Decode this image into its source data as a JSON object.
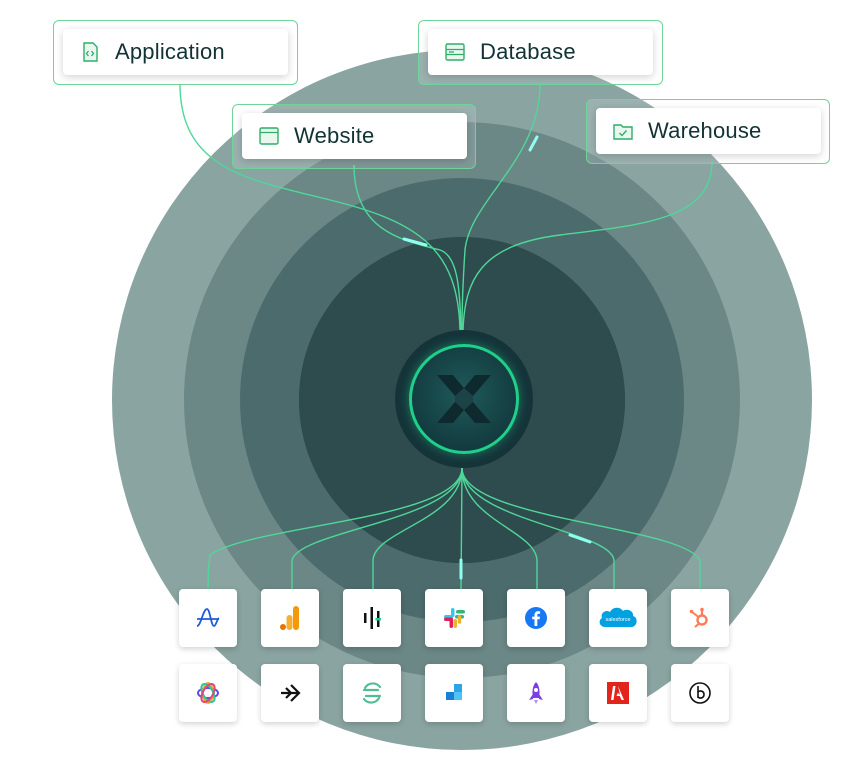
{
  "sources": [
    {
      "label": "Application",
      "icon": "code-file-icon"
    },
    {
      "label": "Website",
      "icon": "browser-window-icon"
    },
    {
      "label": "Database",
      "icon": "database-server-icon"
    },
    {
      "label": "Warehouse",
      "icon": "folder-check-icon"
    }
  ],
  "hub": {
    "icon": "x-logo-icon"
  },
  "destinations_row1": [
    {
      "icon": "amplitude-icon"
    },
    {
      "icon": "google-analytics-icon"
    },
    {
      "icon": "mixpanel-icon"
    },
    {
      "icon": "slack-icon"
    },
    {
      "icon": "facebook-icon"
    },
    {
      "icon": "salesforce-icon",
      "text": "salesforce"
    },
    {
      "icon": "hubspot-icon"
    }
  ],
  "destinations_row2": [
    {
      "icon": "appcues-icon"
    },
    {
      "icon": "arrow-logo-icon"
    },
    {
      "icon": "segment-icon"
    },
    {
      "icon": "blocks-icon"
    },
    {
      "icon": "rocket-icon"
    },
    {
      "icon": "adobe-icon"
    },
    {
      "icon": "braze-icon"
    }
  ],
  "colors": {
    "accent_green": "#1fd08a",
    "line_green": "#4fd79a",
    "ring_outer": "#7f9a97",
    "ring_2": "#5d7a79",
    "ring_3": "#3f5e60",
    "ring_4": "#2b4a4d",
    "hub_bg": "#15343a",
    "text_dark": "#123236"
  }
}
